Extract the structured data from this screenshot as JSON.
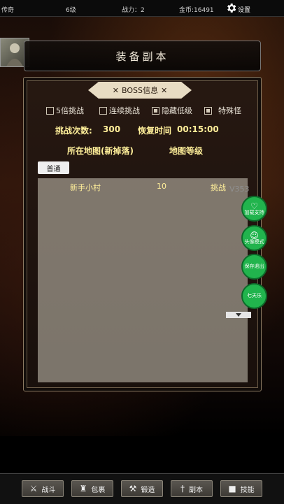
{
  "status_bar": {
    "name": "传奇",
    "level": "6级",
    "power": "战力：2",
    "gold": "金币:16491",
    "settings_label": "设置"
  },
  "header": {
    "title": "装备副本"
  },
  "boss_panel": {
    "tab_title": "BOSS信息",
    "options": [
      {
        "label": "5倍挑战",
        "checked": false
      },
      {
        "label": "连续挑战",
        "checked": false
      },
      {
        "label": "隐藏低级",
        "checked": true
      },
      {
        "label": "特殊怪",
        "checked": true
      }
    ],
    "challenge_count_label": "挑战次数:",
    "challenge_count_value": "300",
    "recovery_label": "恢复时间",
    "recovery_value": "00:15:00",
    "map_col_label": "所在地图(新掉落)",
    "map_level_label": "地图等级",
    "filter_tab": "普通",
    "rows": [
      {
        "map": "新手小村",
        "level": "10",
        "action": "挑战"
      }
    ]
  },
  "version": "V353",
  "float_buttons": [
    {
      "label": "加载支持",
      "icon": "heart-icon"
    },
    {
      "label": "头像模式",
      "icon": "face-icon"
    },
    {
      "label": "保存退出",
      "icon": ""
    },
    {
      "label": "七天乐",
      "icon": ""
    }
  ],
  "bottom_nav": [
    {
      "label": "战斗",
      "icon": "crossed-swords-icon"
    },
    {
      "label": "包裹",
      "icon": "bag-icon"
    },
    {
      "label": "锻造",
      "icon": "hammer-icon"
    },
    {
      "label": "副本",
      "icon": "sword-icon"
    },
    {
      "label": "技能",
      "icon": "book-icon"
    }
  ],
  "colors": {
    "highlight_text": "#ffef9a",
    "float_button": "#21b44d",
    "panel_border": "#8b7a62"
  }
}
